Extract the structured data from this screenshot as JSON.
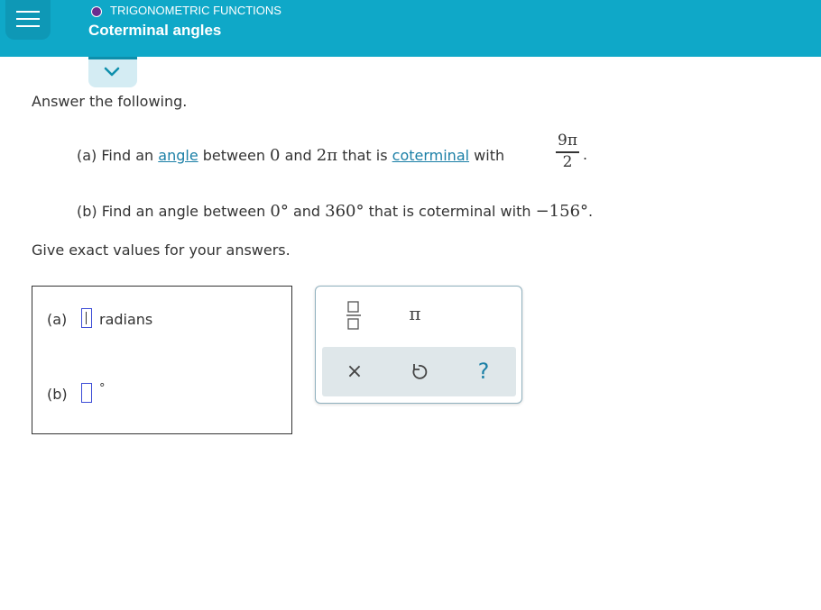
{
  "header": {
    "topic": "TRIGONOMETRIC FUNCTIONS",
    "title": "Coterminal angles",
    "menu_icon": "hamburger-menu-icon",
    "tab_icon": "chevron-down-icon",
    "accent_color": "#0fa8c8",
    "topic_dot_color": "#6a2d8f"
  },
  "question": {
    "intro": "Answer the following.",
    "part_a": {
      "prefix": "(a) Find an",
      "link1": "angle",
      "mid1": "between",
      "lower": "0",
      "and": "and",
      "upper": "2π",
      "mid2": "that is",
      "link2": "coterminal",
      "with": "with",
      "frac_num": "9π",
      "frac_den": "2",
      "end": "."
    },
    "part_b": {
      "prefix": "(b) Find an angle between",
      "lower": "0°",
      "and": "and",
      "upper": "360°",
      "mid": "that is coterminal with",
      "value": "−156°",
      "end": "."
    },
    "instruction": "Give exact values for your answers."
  },
  "answers": {
    "a_label": "(a)",
    "a_unit": "radians",
    "b_label": "(b)",
    "b_unit": "°"
  },
  "keypad": {
    "fraction_key": "fraction-icon",
    "pi_key": "π",
    "clear_key": "×",
    "undo_key": "undo-icon",
    "help_key": "?"
  }
}
